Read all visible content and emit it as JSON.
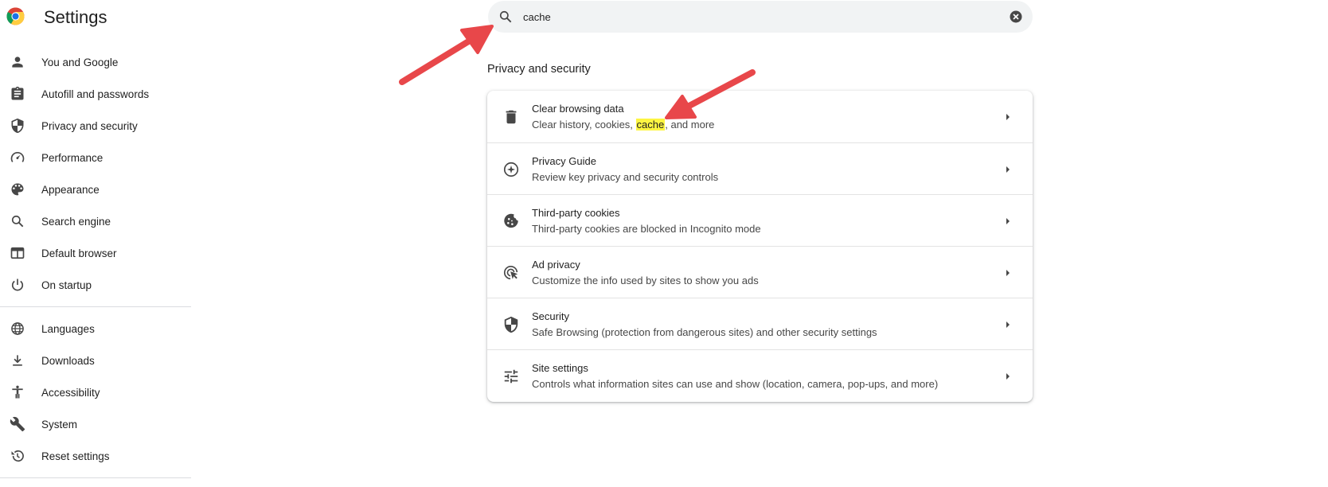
{
  "app": {
    "title": "Settings",
    "logo_icon": "chrome-logo-icon"
  },
  "sidebar": {
    "items": [
      {
        "label": "You and Google",
        "icon": "person-icon"
      },
      {
        "label": "Autofill and passwords",
        "icon": "clipboard-icon"
      },
      {
        "label": "Privacy and security",
        "icon": "shield-icon"
      },
      {
        "label": "Performance",
        "icon": "speedometer-icon"
      },
      {
        "label": "Appearance",
        "icon": "palette-icon"
      },
      {
        "label": "Search engine",
        "icon": "search-icon"
      },
      {
        "label": "Default browser",
        "icon": "browser-window-icon"
      },
      {
        "label": "On startup",
        "icon": "power-icon"
      },
      {
        "label": "Languages",
        "icon": "globe-icon"
      },
      {
        "label": "Downloads",
        "icon": "download-icon"
      },
      {
        "label": "Accessibility",
        "icon": "accessibility-icon"
      },
      {
        "label": "System",
        "icon": "wrench-icon"
      },
      {
        "label": "Reset settings",
        "icon": "history-icon"
      }
    ]
  },
  "search": {
    "value": "cache",
    "placeholder": "Search settings"
  },
  "section": {
    "title": "Privacy and security",
    "rows": [
      {
        "title": "Clear browsing data",
        "subtitle_pre": "Clear history, cookies, ",
        "subtitle_highlight": "cache",
        "subtitle_post": ", and more",
        "icon": "trash-icon"
      },
      {
        "title": "Privacy Guide",
        "subtitle": "Review key privacy and security controls",
        "icon": "compass-icon"
      },
      {
        "title": "Third-party cookies",
        "subtitle": "Third-party cookies are blocked in Incognito mode",
        "icon": "cookie-icon"
      },
      {
        "title": "Ad privacy",
        "subtitle": "Customize the info used by sites to show you ads",
        "icon": "ad-privacy-icon"
      },
      {
        "title": "Security",
        "subtitle": "Safe Browsing (protection from dangerous sites) and other security settings",
        "icon": "shield-icon"
      },
      {
        "title": "Site settings",
        "subtitle": "Controls what information sites can use and show (location, camera, pop-ups, and more)",
        "icon": "tune-sliders-icon"
      }
    ]
  },
  "colors": {
    "highlight": "#fdf542",
    "annotation_arrow": "#e8474a",
    "icon": "#474747"
  }
}
